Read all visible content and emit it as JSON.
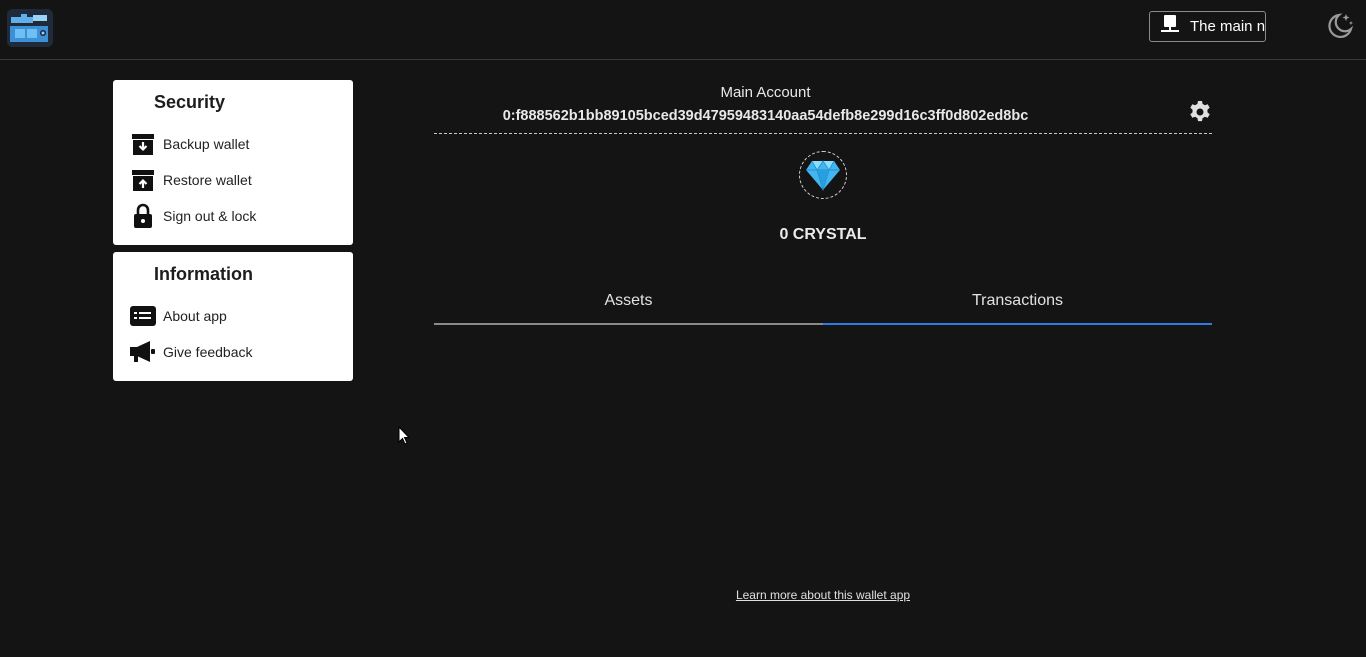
{
  "header": {
    "network_label": "The main n",
    "logo_icon": "wallet-logo-icon",
    "theme_icon": "moon-stars-icon"
  },
  "security": {
    "title": "Security",
    "items": [
      {
        "label": "Backup wallet",
        "icon": "archive-down-icon"
      },
      {
        "label": "Restore wallet",
        "icon": "archive-up-icon"
      },
      {
        "label": "Sign out & lock",
        "icon": "lock-icon"
      }
    ]
  },
  "information": {
    "title": "Information",
    "items": [
      {
        "label": "About app",
        "icon": "list-card-icon"
      },
      {
        "label": "Give feedback",
        "icon": "megaphone-icon"
      }
    ]
  },
  "account": {
    "name": "Main Account",
    "address": "0:f888562b1bb89105bced39d47959483140aa54defb8e299d16c3ff0d802ed8bc",
    "balance": "0 CRYSTAL"
  },
  "tabs": {
    "assets": "Assets",
    "transactions": "Transactions",
    "active": "transactions"
  },
  "footer": {
    "learn_more": "Learn more about this wallet app"
  },
  "colors": {
    "background": "#141414",
    "active_tab": "#2f7be6",
    "card": "#ffffff"
  }
}
